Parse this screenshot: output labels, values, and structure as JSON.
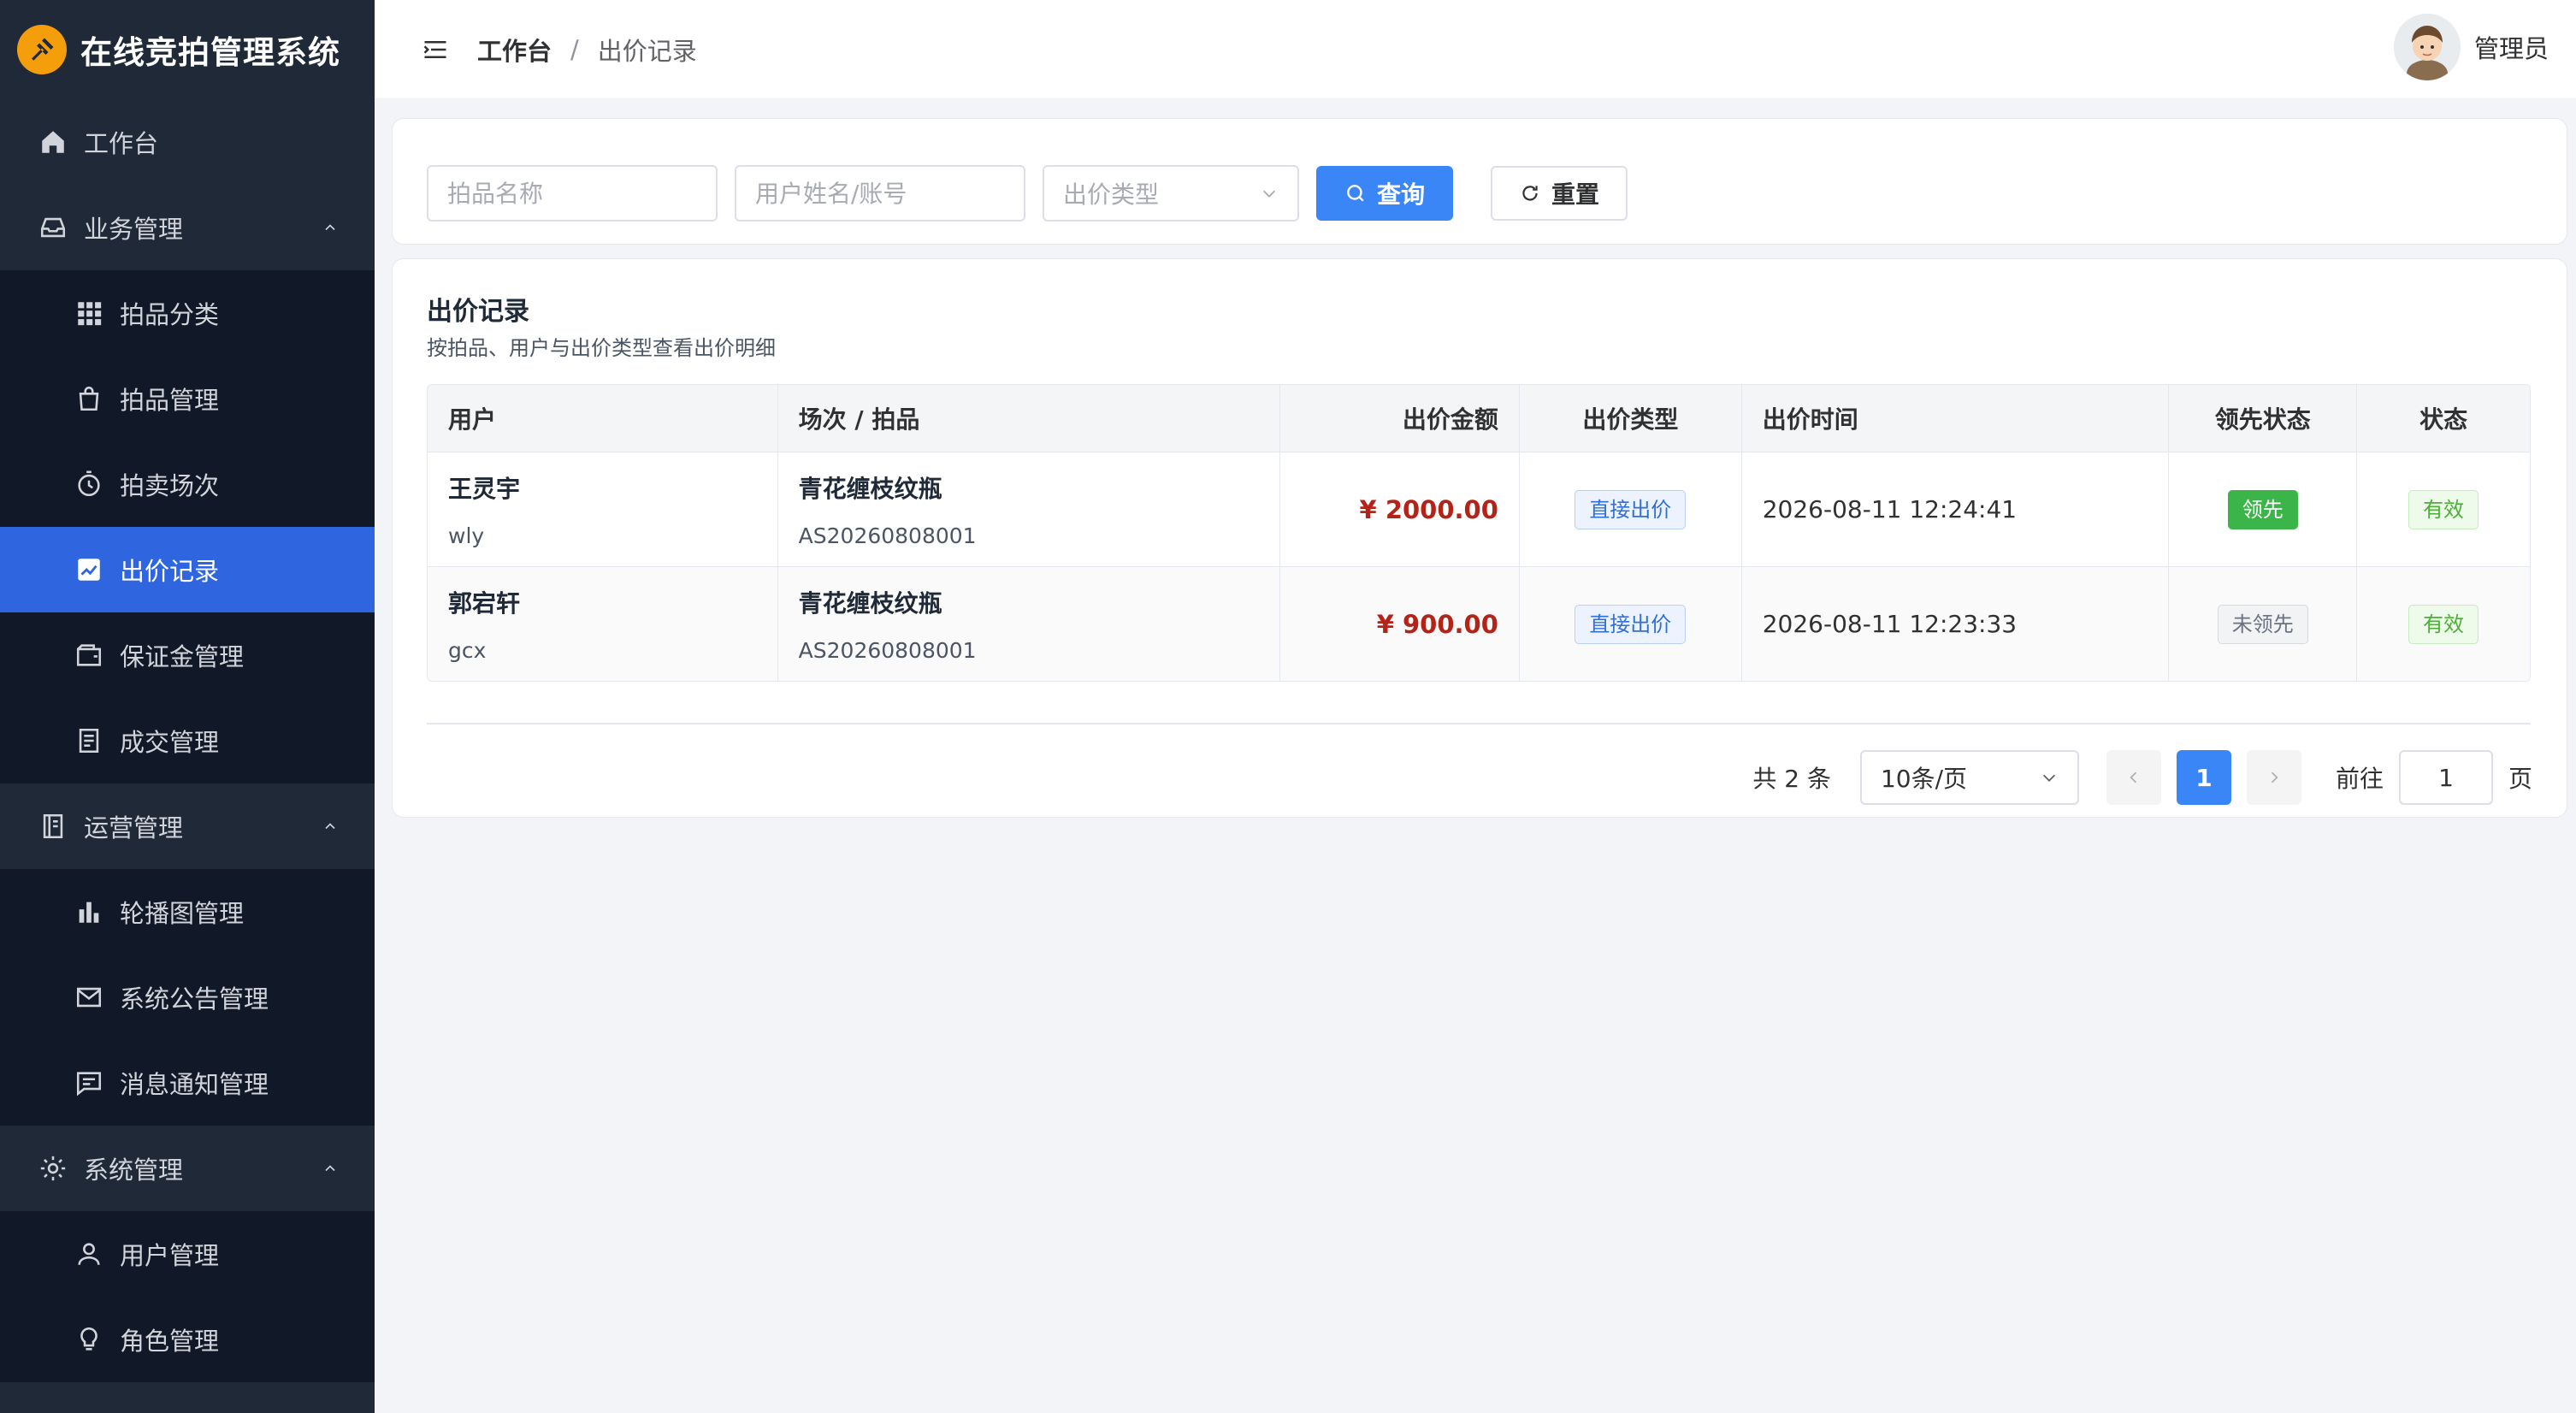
{
  "app": {
    "title": "在线竞拍管理系统"
  },
  "sidebar": {
    "items": [
      {
        "label": "工作台",
        "icon": "home-icon"
      },
      {
        "label": "业务管理",
        "icon": "inbox-icon"
      },
      {
        "label": "拍品分类",
        "icon": "grid-icon"
      },
      {
        "label": "拍品管理",
        "icon": "bag-icon"
      },
      {
        "label": "拍卖场次",
        "icon": "stopwatch-icon"
      },
      {
        "label": "出价记录",
        "icon": "chart-icon"
      },
      {
        "label": "保证金管理",
        "icon": "wallet-icon"
      },
      {
        "label": "成交管理",
        "icon": "document-icon"
      },
      {
        "label": "运营管理",
        "icon": "notebook-icon"
      },
      {
        "label": "轮播图管理",
        "icon": "bar-chart-icon"
      },
      {
        "label": "系统公告管理",
        "icon": "mail-icon"
      },
      {
        "label": "消息通知管理",
        "icon": "message-icon"
      },
      {
        "label": "系统管理",
        "icon": "gear-icon"
      },
      {
        "label": "用户管理",
        "icon": "user-icon"
      },
      {
        "label": "角色管理",
        "icon": "bulb-icon"
      }
    ],
    "active_color": "#2f66e0"
  },
  "header": {
    "breadcrumb_root": "工作台",
    "breadcrumb_sep": "/",
    "breadcrumb_current": "出价记录",
    "user_name": "管理员"
  },
  "filters": {
    "item_name_placeholder": "拍品名称",
    "user_placeholder": "用户姓名/账号",
    "bid_type_placeholder": "出价类型",
    "search_label": "查询",
    "reset_label": "重置"
  },
  "list": {
    "title": "出价记录",
    "subtitle": "按拍品、用户与出价类型查看出价明细",
    "columns": [
      "用户",
      "场次 / 拍品",
      "出价金额",
      "出价类型",
      "出价时间",
      "领先状态",
      "状态"
    ],
    "rows": [
      {
        "user_name": "王灵宇",
        "user_account": "wly",
        "item_name": "青花缠枝纹瓶",
        "session_no": "AS20260808001",
        "amount": "¥ 2000.00",
        "bid_type": "直接出价",
        "time": "2026-08-11 12:24:41",
        "lead": "领先",
        "status": "有效"
      },
      {
        "user_name": "郭宕轩",
        "user_account": "gcx",
        "item_name": "青花缠枝纹瓶",
        "session_no": "AS20260808001",
        "amount": "¥ 900.00",
        "bid_type": "直接出价",
        "time": "2026-08-11 12:23:33",
        "lead": "未领先",
        "status": "有效"
      }
    ]
  },
  "pagination": {
    "total": "共 2 条",
    "page_size": "10条/页",
    "current_page": "1",
    "goto_label": "前往",
    "goto_value": "1",
    "page_suffix": "页"
  }
}
